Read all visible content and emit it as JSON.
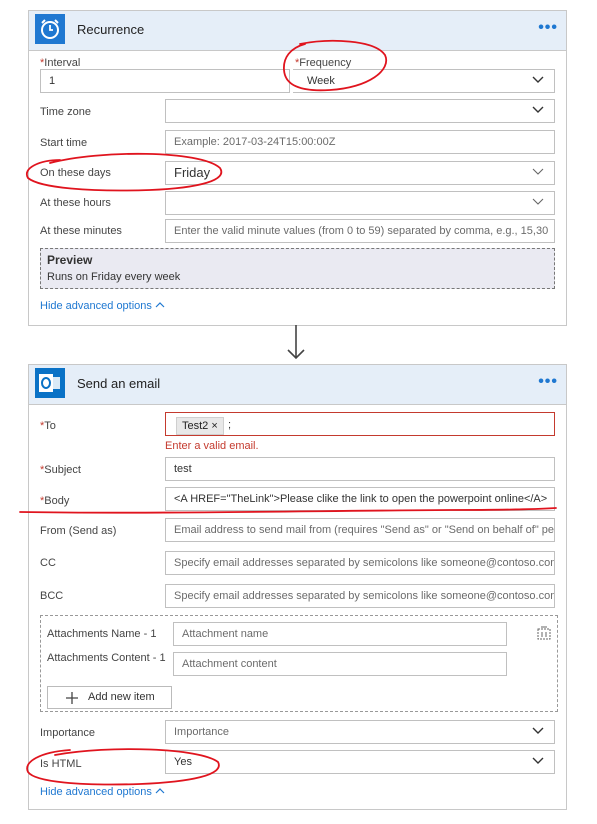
{
  "recurrence": {
    "title": "Recurrence",
    "more": "•••",
    "interval_label": "Interval",
    "interval_value": "1",
    "frequency_label": "Frequency",
    "frequency_value": "Week",
    "timezone_label": "Time zone",
    "starttime_label": "Start time",
    "starttime_placeholder": "Example: 2017-03-24T15:00:00Z",
    "days_label": "On these days",
    "days_value": "Friday",
    "hours_label": "At these hours",
    "minutes_label": "At these minutes",
    "minutes_placeholder": "Enter the valid minute values (from 0 to 59) separated by comma, e.g., 15,30",
    "preview_title": "Preview",
    "preview_text": "Runs on Friday every week",
    "hide_advanced": "Hide advanced options"
  },
  "email": {
    "title": "Send an email",
    "more": "•••",
    "to_label": "To",
    "to_tag": "Test2",
    "to_tag_close": "×",
    "to_suffix": ";",
    "to_error": "Enter a valid email.",
    "subject_label": "Subject",
    "subject_value": "test",
    "body_label": "Body",
    "body_value": "<A HREF=\"TheLink\">Please clike the link to open the powerpoint online</A>",
    "from_label": "From (Send as)",
    "from_placeholder": "Email address to send mail from (requires \"Send as\" or \"Send on behalf of\" pe",
    "cc_label": "CC",
    "cc_placeholder": "Specify email addresses separated by semicolons like someone@contoso.com",
    "bcc_label": "BCC",
    "bcc_placeholder": "Specify email addresses separated by semicolons like someone@contoso.com",
    "attach_name_label": "Attachments Name - 1",
    "attach_name_placeholder": "Attachment name",
    "attach_content_label": "Attachments Content - 1",
    "attach_content_placeholder": "Attachment content",
    "add_item": "Add new item",
    "importance_label": "Importance",
    "importance_placeholder": "Importance",
    "ishtml_label": "Is HTML",
    "ishtml_value": "Yes",
    "hide_advanced": "Hide advanced options"
  },
  "colors": {
    "header_bg": "#e5eef8",
    "link": "#1f78d1",
    "required": "#c43a2e",
    "annotation_red": "#e0141e",
    "outlook_blue": "#0a72c6"
  }
}
